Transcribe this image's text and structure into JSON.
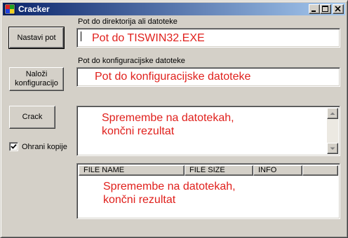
{
  "window": {
    "title": "Cracker"
  },
  "caption_buttons": {
    "minimize": "minimize",
    "maximize": "maximize",
    "close": "close"
  },
  "buttons": {
    "set_path": "Nastavi pot",
    "load_config": "Naloži\nkonfiguracijo",
    "crack": "Crack"
  },
  "fields": {
    "path_label": "Pot do direktorija ali datoteke",
    "path_value": "Pot do TISWIN32.EXE",
    "config_label": "Pot do konfiguracijske datoteke",
    "config_value": "Pot do konfiguracijske datoteke"
  },
  "output": {
    "text": "Spremembe na datotekah,\nkončni rezultat"
  },
  "backup": {
    "label": "Ohrani kopije",
    "checked": true
  },
  "file_list": {
    "columns": [
      "FILE NAME",
      "FILE SIZE",
      "INFO"
    ],
    "overlay_text": "Spremembe na datotekah,\nkončni rezultat"
  },
  "colors": {
    "title_gradient_start": "#0a246a",
    "title_gradient_end": "#a6caf0",
    "annotation_red": "#e0201c",
    "window_face": "#d4d0c8"
  }
}
